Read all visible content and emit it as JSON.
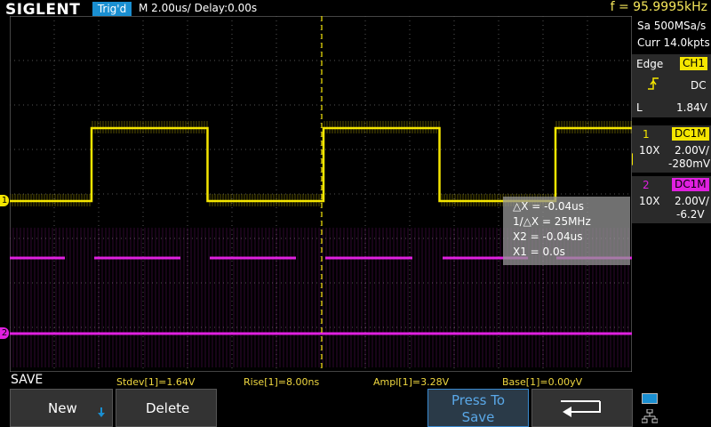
{
  "header": {
    "logo": "SIGLENT",
    "trigger_status": "Trig'd",
    "timebase": "M 2.00us/  Delay:0.00s",
    "frequency": "f = 95.9995kHz"
  },
  "acquisition": {
    "sample_rate": "Sa 500MSa/s",
    "memory": "Curr 14.0kpts"
  },
  "trigger": {
    "type": "Edge",
    "source": "CH1",
    "coupling": "DC",
    "level_label": "L",
    "level": "1.84V"
  },
  "channels": [
    {
      "number": "1",
      "coupling": "DC1M",
      "probe": "10X",
      "scale": "2.00V/",
      "offset": "-280mV",
      "color": "#f5e600"
    },
    {
      "number": "2",
      "coupling": "DC1M",
      "probe": "10X",
      "scale": "2.00V/",
      "offset": "-6.2V",
      "color": "#e020e0"
    }
  ],
  "markers": {
    "ch1": "1",
    "ch2": "2"
  },
  "cursors": {
    "delta_x": "△X = -0.04us",
    "inv_delta_x": "1/△X = 25MHz",
    "x2": "X2 = -0.04us",
    "x1": "X1 = 0.0s"
  },
  "measurements": {
    "stdev": "Stdev[1]=1.64V",
    "rise": "Rise[1]=8.00ns",
    "ampl": "Ampl[1]=3.28V",
    "base": "Base[1]=0.00yV"
  },
  "menu": {
    "title": "SAVE",
    "new_label": "New",
    "delete_label": "Delete",
    "press_to_save_line1": "Press To",
    "press_to_save_line2": "Save"
  },
  "colors": {
    "ch1": "#f5e600",
    "ch2": "#e020e0",
    "trigger_blue": "#1a8fd1",
    "frequency": "#f5e65a",
    "measurement": "#f0d840"
  }
}
